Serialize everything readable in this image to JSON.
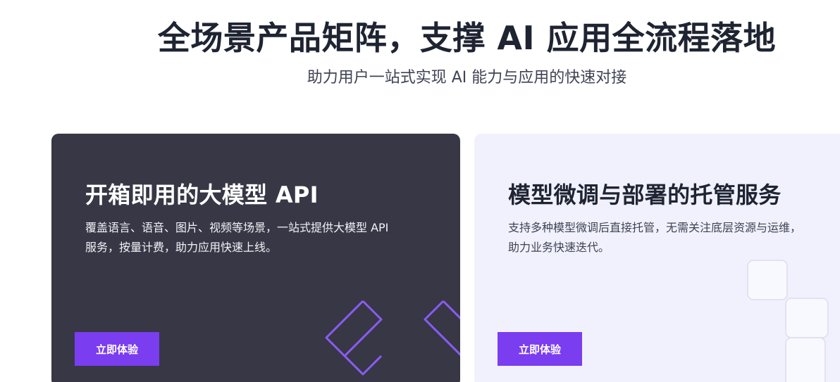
{
  "hero": {
    "title": "全场景产品矩阵，支撑 AI 应用全流程落地",
    "subtitle": "助力用户一站式实现 AI 能力与应用的快速对接"
  },
  "cards": [
    {
      "title": "开箱即用的大模型 API",
      "desc_lines": [
        "覆盖语言、语音、图片、视频等场景，一站式提供大模型 API",
        "服务，按量计费，助力应用快速上线。"
      ],
      "button_label": "立即体验"
    },
    {
      "title": "模型微调与部署的托管服务",
      "desc_lines": [
        "支持多种模型微调后直接托管，无需关注底层资源与运维，",
        "助力业务快速迭代。"
      ],
      "button_label": "立即体验"
    }
  ],
  "colors": {
    "dark_card": "#373746",
    "light_card": "#f1f1fe",
    "accent": "#7b3df0",
    "heading": "#1f2432"
  }
}
